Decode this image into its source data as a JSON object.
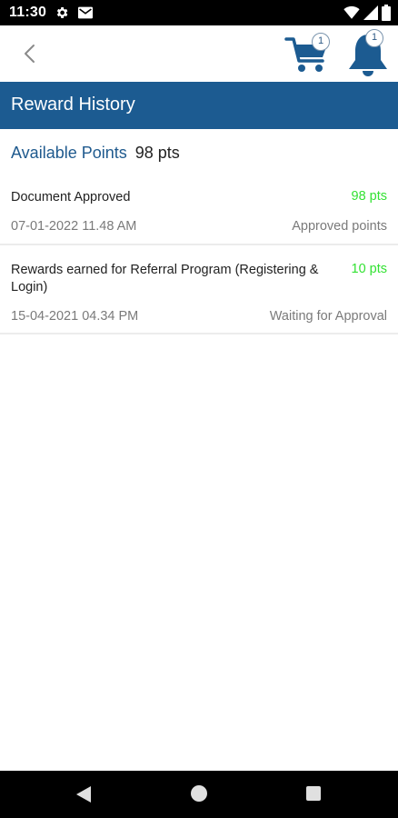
{
  "status_bar": {
    "time": "11:30",
    "icons": [
      "gear-icon",
      "mail-icon",
      "wifi-icon",
      "signal-icon",
      "battery-icon"
    ]
  },
  "top_bar": {
    "back_icon": "chevron-left-icon",
    "cart": {
      "icon": "shopping-cart-icon",
      "badge_count": "1"
    },
    "notifications": {
      "icon": "bell-icon",
      "badge_count": "1"
    }
  },
  "header": {
    "title": "Reward History",
    "background_color": "#1c5b91"
  },
  "summary": {
    "label": "Available Points",
    "value": "98 pts"
  },
  "rewards": [
    {
      "title": "Document Approved",
      "points": "98 pts",
      "date": "07-01-2022 11.48 AM",
      "status": "Approved points"
    },
    {
      "title": "Rewards earned for Referral Program (Registering & Login)",
      "points": "10 pts",
      "date": "15-04-2021 04.34 PM",
      "status": "Waiting for Approval"
    }
  ],
  "colors": {
    "accent": "#1f5a8e",
    "points_green": "#33e233",
    "muted_text": "#7a7a7a"
  },
  "nav_bar": {
    "icons": [
      "back-triangle-icon",
      "home-circle-icon",
      "recents-square-icon"
    ]
  }
}
